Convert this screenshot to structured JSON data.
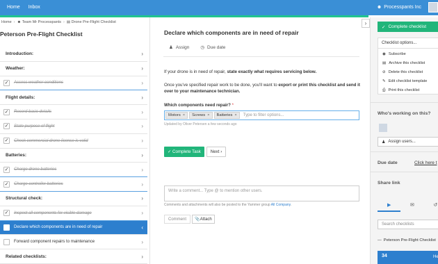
{
  "topbar": {
    "nav": [
      "Home",
      "Inbox"
    ],
    "org_name": "Processpants Inc"
  },
  "breadcrumb": {
    "home": "Home",
    "team": "Team Mr Processpants",
    "checklist": "Drone Pre-Flight Checklist"
  },
  "checklist": {
    "title": "Peterson Pre-Flight Checklist",
    "rows": [
      {
        "type": "heading",
        "label": "Introduction:"
      },
      {
        "type": "heading",
        "label": "Weather:"
      },
      {
        "type": "task",
        "label": "Assess weather conditions",
        "done": true
      },
      {
        "type": "heading",
        "label": "Flight details:"
      },
      {
        "type": "task",
        "label": "Record basic details",
        "done": true
      },
      {
        "type": "task",
        "label": "State purpose of flight",
        "done": true
      },
      {
        "type": "task",
        "label": "Check commercial drone license is valid",
        "done": true
      },
      {
        "type": "heading",
        "label": "Batteries:"
      },
      {
        "type": "task",
        "label": "Charge drone batteries",
        "done": true
      },
      {
        "type": "task",
        "label": "Charge controller batteries",
        "done": true
      },
      {
        "type": "heading",
        "label": "Structural check:"
      },
      {
        "type": "task",
        "label": "Inspect all components for visible damage",
        "done": true
      },
      {
        "type": "task",
        "label": "Declare which components are in need of repair",
        "done": false,
        "active": true
      },
      {
        "type": "task",
        "label": "Forward component repairs to maintenance",
        "done": false
      },
      {
        "type": "heading",
        "label": "Related checklists:"
      }
    ]
  },
  "task": {
    "title": "Declare which components are in need of repair",
    "assign_label": "Assign",
    "due_label": "Due date",
    "p1_prefix": "If your drone is in need of repair, ",
    "p1_bold": "state exactly what requires servicing below.",
    "p2_prefix": "Once you've specified repair work to be done, you'll want to ",
    "p2_bold": "export or print this checklist and send it over to your maintenance technician.",
    "field_label": "Which components need repair?",
    "required_mark": "*",
    "selected": [
      "Motors",
      "Screws",
      "Batteries"
    ],
    "filter_placeholder": "Type to filter options...",
    "updated_note": "Updated by Oliver Petersen a few seconds ago",
    "complete_label": "Complete Task",
    "next_label": "Next",
    "comment_placeholder": "Write a comment... Type @ to mention other users.",
    "comment_note_prefix": "Comments and attachments will also be posted to the Yammer group ",
    "comment_note_link": "All Company",
    "comment_note_suffix": ".",
    "comment_button": "Comment",
    "attach_button": "Attach"
  },
  "right": {
    "complete_checklist": "Complete checklist",
    "options_title": "Checklist options...",
    "options": [
      "Subscribe",
      "Archive this checklist",
      "Delete this checklist",
      "Edit checklist template",
      "Print this checklist"
    ],
    "working_title": "Who's working on this?",
    "assign_users": "Assign users...",
    "due_title": "Due date",
    "due_link": "Click here t",
    "share_title": "Share link",
    "search_placeholder": "Search checklists",
    "checklist_link": "Peterson Pre-Flight Checklist",
    "count": "34",
    "help": "He"
  },
  "colors": {
    "topbar": "#3a8fd6",
    "accent_green": "#21b57a",
    "active_blue": "#2d7fce"
  }
}
